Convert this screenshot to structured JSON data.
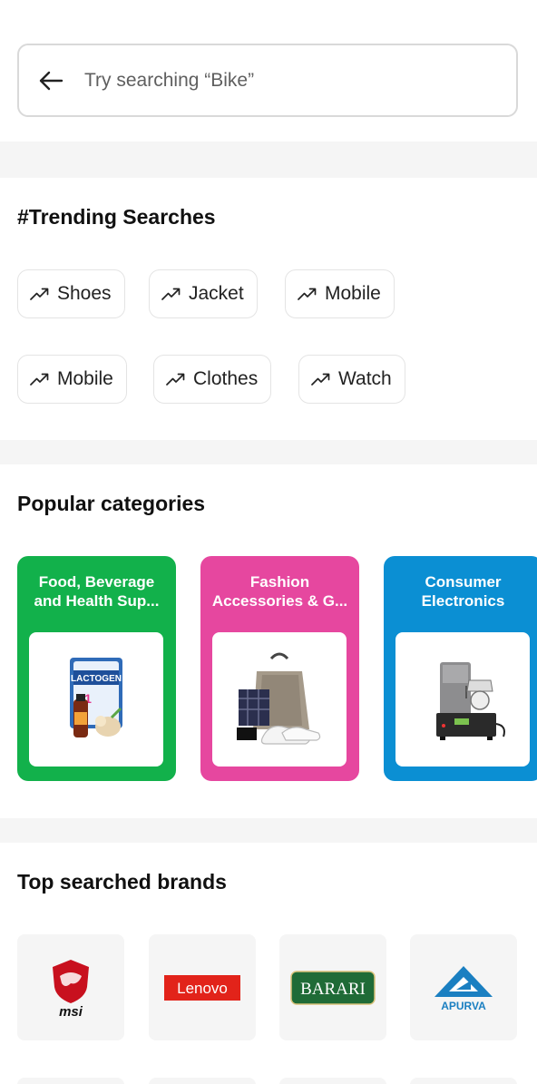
{
  "search": {
    "placeholder": "Try searching “Bike”"
  },
  "trending": {
    "title": "#Trending Searches",
    "chips": [
      "Shoes",
      "Jacket",
      "Mobile",
      "Mobile",
      "Clothes",
      "Watch"
    ]
  },
  "categories": {
    "title": "Popular categories",
    "items": [
      {
        "label": "Food, Beverage and Health Sup...",
        "color": "#12b14b"
      },
      {
        "label": "Fashion Accessories & G...",
        "color": "#e6479f"
      },
      {
        "label": "Consumer Electronics",
        "color": "#0b8fd3"
      }
    ],
    "product_text": {
      "lactogen": "LACTOGEN",
      "lactogen_stage": "1"
    }
  },
  "brands": {
    "title": "Top searched brands",
    "items": [
      {
        "name": "msi"
      },
      {
        "name": "Lenovo"
      },
      {
        "name": "BARARI"
      },
      {
        "name": "APURVA"
      }
    ]
  },
  "colors": {
    "accent_green": "#12b14b",
    "accent_pink": "#e6479f",
    "accent_blue": "#0b8fd3",
    "band": "#f5f5f5"
  }
}
